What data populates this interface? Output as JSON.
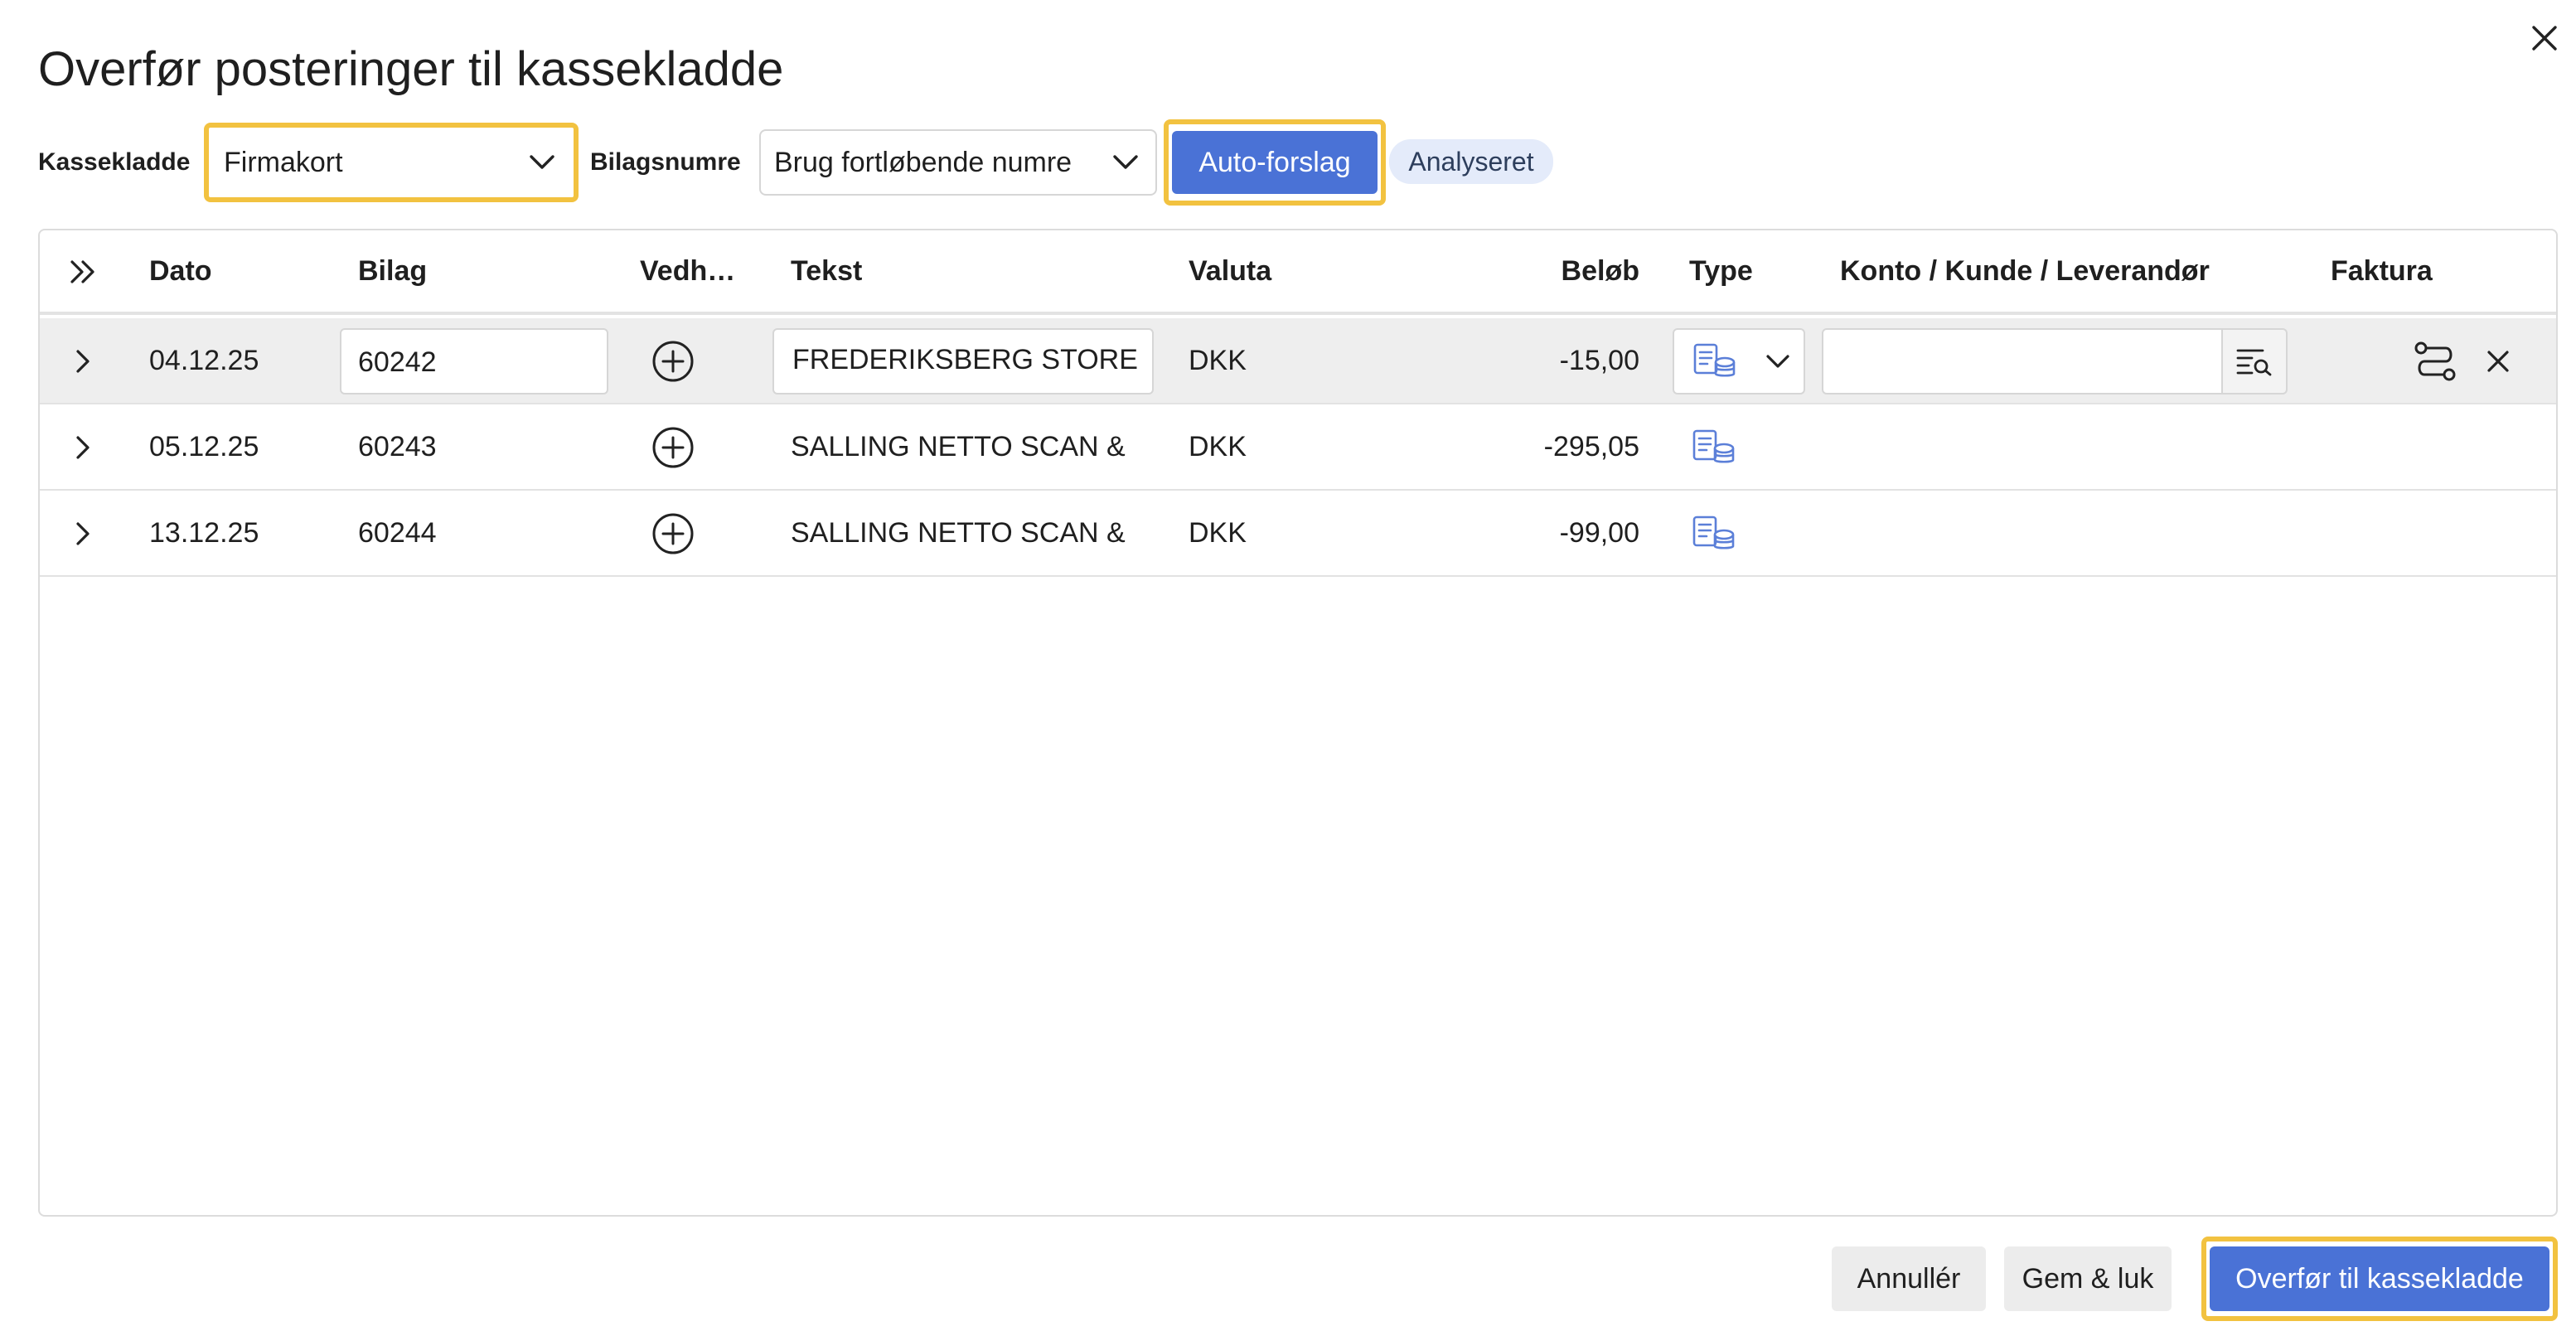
{
  "dialog": {
    "title": "Overfør posteringer til kassekladde"
  },
  "filters": {
    "kassekladde_label": "Kassekladde",
    "kassekladde_value": "Firmakort",
    "bilagsnumre_label": "Bilagsnumre",
    "bilagsnumre_value": "Brug fortløbende numre",
    "auto_button": "Auto-forslag",
    "status_badge": "Analyseret"
  },
  "table": {
    "columns": {
      "dato": "Dato",
      "bilag": "Bilag",
      "vedh": "Vedh…",
      "tekst": "Tekst",
      "valuta": "Valuta",
      "belob": "Beløb",
      "type": "Type",
      "konto": "Konto / Kunde / Leverandør",
      "faktura": "Faktura"
    },
    "rows": [
      {
        "dato": "04.12.25",
        "bilag": "60242",
        "tekst": "FREDERIKSBERG STORE",
        "valuta": "DKK",
        "belob": "-15,00",
        "type_icon": "ledger-coins-icon",
        "konto": ""
      },
      {
        "dato": "05.12.25",
        "bilag": "60243",
        "tekst": "SALLING NETTO SCAN &",
        "valuta": "DKK",
        "belob": "-295,05",
        "type_icon": "ledger-coins-icon"
      },
      {
        "dato": "13.12.25",
        "bilag": "60244",
        "tekst": "SALLING NETTO SCAN &",
        "valuta": "DKK",
        "belob": "-99,00",
        "type_icon": "ledger-coins-icon"
      }
    ]
  },
  "footer": {
    "cancel": "Annullér",
    "save_close": "Gem & luk",
    "transfer": "Overfør til kassekladde"
  },
  "colors": {
    "primary": "#4a72d6",
    "highlight": "#f2c240",
    "badge_bg": "#e4ebfa",
    "icon_blue": "#5b7fd8"
  }
}
